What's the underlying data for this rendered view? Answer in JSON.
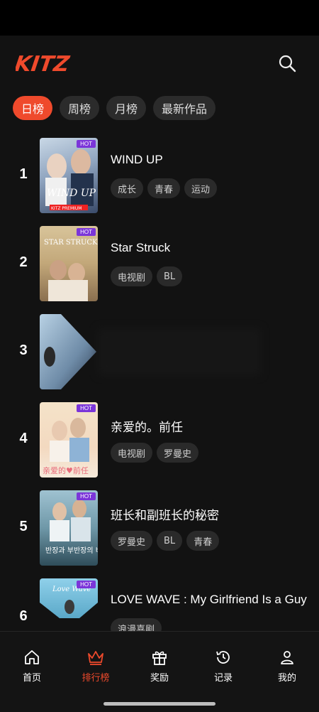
{
  "app": {
    "name": "KITZ",
    "accent": "#ef4a2c"
  },
  "header": {
    "logo_text": "KITZ"
  },
  "tabs": [
    {
      "label": "日榜",
      "active": true
    },
    {
      "label": "周榜",
      "active": false
    },
    {
      "label": "月榜",
      "active": false
    },
    {
      "label": "最新作品",
      "active": false
    }
  ],
  "list": [
    {
      "rank": "1",
      "title": "WIND UP",
      "hot": "HOT",
      "poster_text": "WIND UP",
      "poster_badge": "KITZ PREMIUM",
      "tags": [
        "成长",
        "青春",
        "运动"
      ]
    },
    {
      "rank": "2",
      "title": "Star Struck",
      "hot": "HOT",
      "poster_text": "STAR STRUCK",
      "tags": [
        "电视剧",
        "BL"
      ]
    },
    {
      "rank": "3",
      "title": "",
      "hot": "",
      "tags": []
    },
    {
      "rank": "4",
      "title": "亲爱的。前任",
      "hot": "HOT",
      "poster_text": "亲爱的♥前任",
      "tags": [
        "电视剧",
        "罗曼史"
      ]
    },
    {
      "rank": "5",
      "title": "班长和副班长的秘密",
      "hot": "HOT",
      "poster_text": "반장과 부반장의 비밀",
      "tags": [
        "罗曼史",
        "BL",
        "青春"
      ]
    },
    {
      "rank": "6",
      "title": "LOVE WAVE : My Girlfriend Is a Guy",
      "hot": "HOT",
      "poster_text": "Love Wave",
      "tags": [
        "浪漫喜剧"
      ]
    }
  ],
  "bottom_nav": [
    {
      "label": "首页",
      "icon": "home-icon",
      "active": false
    },
    {
      "label": "排行榜",
      "icon": "crown-icon",
      "active": true
    },
    {
      "label": "奖励",
      "icon": "gift-icon",
      "active": false
    },
    {
      "label": "记录",
      "icon": "history-icon",
      "active": false
    },
    {
      "label": "我的",
      "icon": "profile-icon",
      "active": false
    }
  ]
}
